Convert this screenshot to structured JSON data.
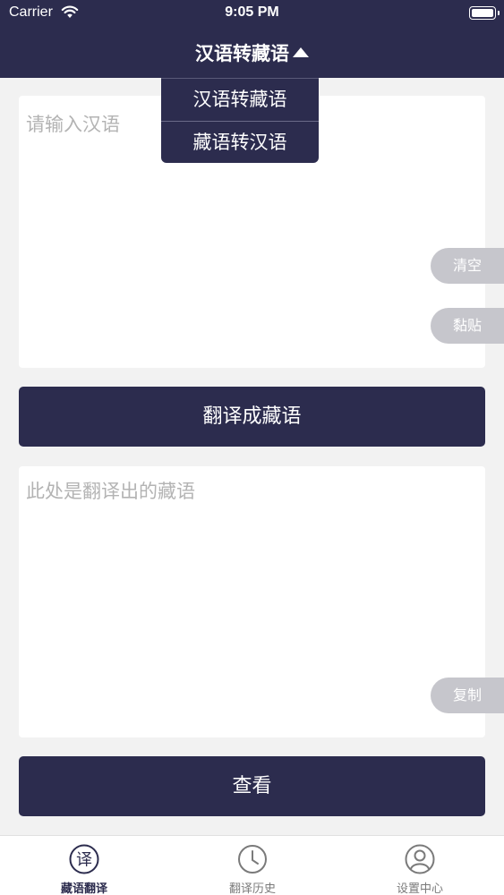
{
  "status_bar": {
    "carrier": "Carrier",
    "time": "9:05 PM"
  },
  "header": {
    "title": "汉语转藏语",
    "dropdown_options": [
      "汉语转藏语",
      "藏语转汉语"
    ]
  },
  "input": {
    "placeholder": "请输入汉语",
    "clear_label": "清空",
    "paste_label": "黏贴"
  },
  "translate_button": "翻译成藏语",
  "output": {
    "placeholder": "此处是翻译出的藏语",
    "copy_label": "复制"
  },
  "view_button": "查看",
  "tabbar": {
    "tabs": [
      {
        "label": "藏语翻译",
        "icon": "translate-icon",
        "active": true
      },
      {
        "label": "翻译历史",
        "icon": "clock-icon",
        "active": false
      },
      {
        "label": "设置中心",
        "icon": "user-icon",
        "active": false
      }
    ]
  },
  "colors": {
    "primary": "#2c2c4e",
    "background": "#f2f2f2",
    "placeholder": "#b3b3b3",
    "side_button": "#c6c6cc"
  }
}
